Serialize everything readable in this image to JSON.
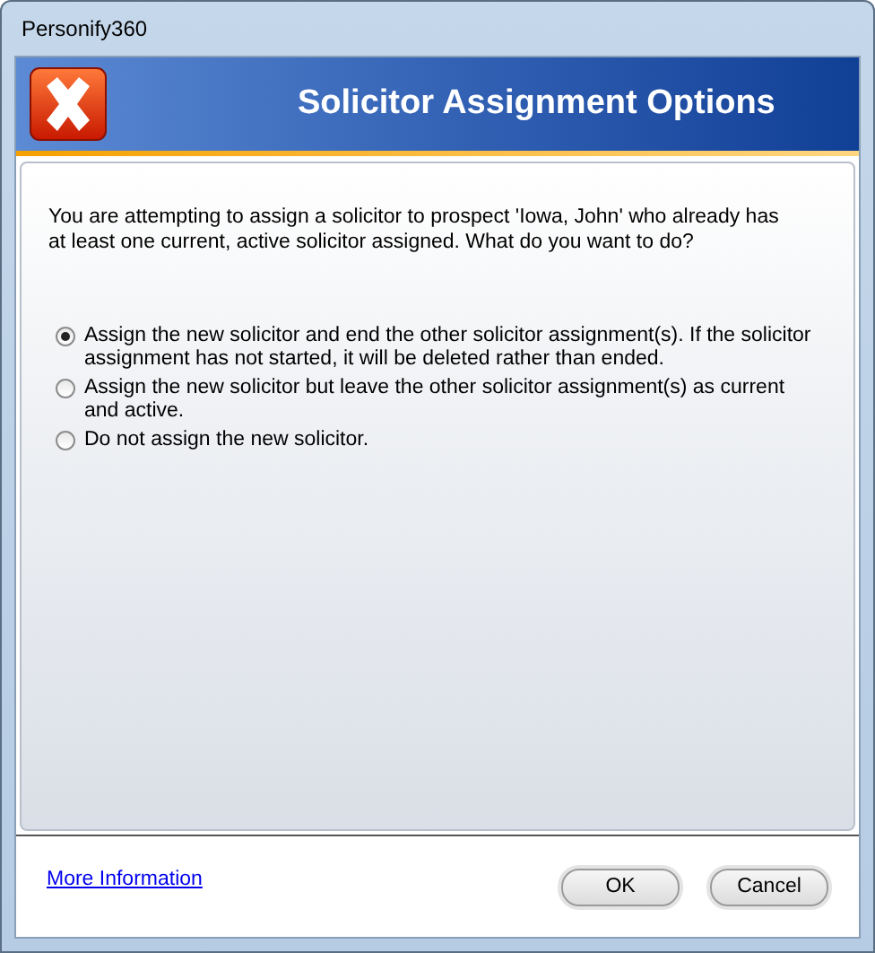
{
  "window": {
    "title": "Personify360"
  },
  "header": {
    "title": "Solicitor Assignment Options"
  },
  "message": "You are attempting to assign a solicitor to prospect 'Iowa, John' who already has at least one current, active solicitor assigned. What do you want to do?",
  "options": [
    {
      "label": "Assign the new solicitor and end the other solicitor assignment(s). If the solicitor assignment has not started, it will be deleted rather than ended.",
      "selected": true
    },
    {
      "label": "Assign the new solicitor but leave the other solicitor assignment(s) as current and active.",
      "selected": false
    },
    {
      "label": "Do not assign the new solicitor.",
      "selected": false
    }
  ],
  "footer": {
    "link": "More Information",
    "buttons": [
      "OK",
      "Cancel"
    ]
  }
}
